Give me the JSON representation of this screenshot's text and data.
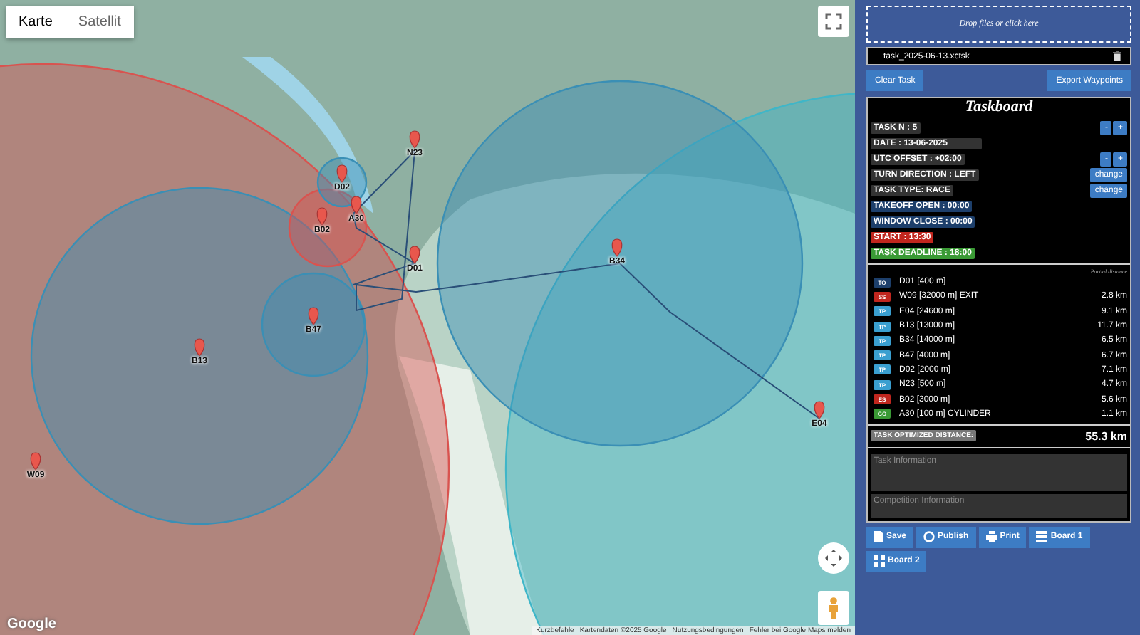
{
  "map": {
    "tabs": [
      {
        "label": "Karte",
        "selected": true
      },
      {
        "label": "Satellit",
        "selected": false
      }
    ],
    "circles": [
      {
        "color": "#d9534f"
      },
      {
        "color": "#3fb6c8"
      },
      {
        "color": "#3a8fb5"
      },
      {
        "color": "#3a8fb5"
      },
      {
        "color": "#3a8fb5"
      },
      {
        "color": "#d9534f"
      },
      {
        "color": "#3a8fb5"
      }
    ],
    "markers": [
      {
        "label": "N23"
      },
      {
        "label": "D02"
      },
      {
        "label": "A30"
      },
      {
        "label": "B02"
      },
      {
        "label": "B34"
      },
      {
        "label": "D01"
      },
      {
        "label": "B47"
      },
      {
        "label": "B13"
      },
      {
        "label": "E04"
      },
      {
        "label": "W09"
      }
    ],
    "logo": "Google",
    "attribution": [
      "Kurzbefehle",
      "Kartendaten ©2025 Google",
      "Nutzungsbedingungen",
      "Fehler bei Google Maps melden"
    ]
  },
  "panel": {
    "dropzone": "Drop files or click here",
    "file_name": "task_2025-06-13.xctsk",
    "buttons": [
      "Clear Task",
      "Export Waypoints"
    ],
    "title": "Taskboard",
    "fields": [
      {
        "text": "TASK N : 5",
        "color": "#333333",
        "controls": [
          "-",
          "+"
        ]
      },
      {
        "text": "DATE : 13-06-2025",
        "color": "#333333"
      },
      {
        "text": "UTC OFFSET : +02:00",
        "color": "#333333",
        "controls": [
          "-",
          "+"
        ]
      },
      {
        "text": "TURN DIRECTION : LEFT",
        "color": "#333333",
        "controls": [
          "change"
        ]
      },
      {
        "text": "TASK TYPE: RACE",
        "color": "#333333",
        "controls": [
          "change"
        ]
      },
      {
        "text": "TAKEOFF OPEN : 00:00",
        "color": "#1d3f6b"
      },
      {
        "text": "WINDOW CLOSE : 00:00",
        "color": "#1d3f6b"
      },
      {
        "text": "START : 13:30",
        "color": "#c0261e"
      },
      {
        "text": "TASK DEADLINE : 18:00",
        "color": "#3a9a35"
      }
    ],
    "partial_header": "Partial distance",
    "turnpoints": [
      {
        "type": "TO",
        "color": "#1d3f6b",
        "name": "D01 [400 m]"
      },
      {
        "type": "SS",
        "color": "#c0261e",
        "name": "W09 [32000 m] EXIT",
        "distance": "2.8 km"
      },
      {
        "type": "TP",
        "color": "#3a9fd0",
        "name": "E04 [24600 m]",
        "distance": "9.1 km"
      },
      {
        "type": "TP",
        "color": "#3a9fd0",
        "name": "B13 [13000 m]",
        "distance": "11.7 km"
      },
      {
        "type": "TP",
        "color": "#3a9fd0",
        "name": "B34 [14000 m]",
        "distance": "6.5 km"
      },
      {
        "type": "TP",
        "color": "#3a9fd0",
        "name": "B47 [4000 m]",
        "distance": "6.7 km"
      },
      {
        "type": "TP",
        "color": "#3a9fd0",
        "name": "D02 [2000 m]",
        "distance": "7.1 km"
      },
      {
        "type": "TP",
        "color": "#3a9fd0",
        "name": "N23 [500 m]",
        "distance": "4.7 km"
      },
      {
        "type": "ES",
        "color": "#c0261e",
        "name": "B02 [3000 m]",
        "distance": "5.6 km"
      },
      {
        "type": "GO",
        "color": "#3a9a35",
        "name": "A30 [100 m] CYLINDER",
        "distance": "1.1 km"
      }
    ],
    "total_label": "TASK OPTIMIZED DISTANCE:",
    "total_value": "55.3 km",
    "textareas": [
      {
        "placeholder": "Task Information"
      },
      {
        "placeholder": "Competition Information"
      }
    ],
    "actions": [
      {
        "kind": "save",
        "label": "Save"
      },
      {
        "kind": "publish",
        "label": "Publish"
      },
      {
        "kind": "print",
        "label": "Print"
      },
      {
        "kind": "list",
        "label": "Board 1"
      },
      {
        "kind": "grid",
        "label": "Board 2"
      }
    ]
  }
}
